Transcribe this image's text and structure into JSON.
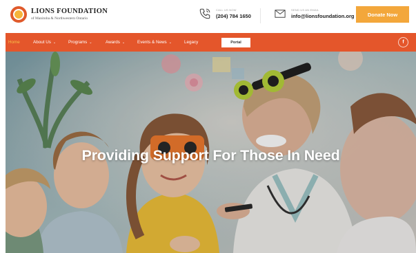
{
  "header": {
    "logo": {
      "title": "LIONS FOUNDATION",
      "subtitle": "of Manitoba & Northwestern Ontario"
    },
    "phone": {
      "label": "CALL US NOW",
      "value": "(204) 784 1650",
      "icon": "phone-icon"
    },
    "email": {
      "label": "SEND US AN EMAIL",
      "value": "info@lionsfoundation.org",
      "icon": "mail-icon"
    },
    "donate_label": "Donate Now"
  },
  "nav": {
    "items": [
      {
        "label": "Home",
        "active": true
      },
      {
        "label": "About Us",
        "dropdown": true
      },
      {
        "label": "Programs",
        "dropdown": true
      },
      {
        "label": "Awards",
        "dropdown": true
      },
      {
        "label": "Events & News",
        "dropdown": true
      },
      {
        "label": "Legacy"
      }
    ],
    "chevron": "⌄",
    "portal_label": "Portal",
    "facebook_glyph": "f"
  },
  "hero": {
    "title": "Providing Support For Those In Need"
  },
  "colors": {
    "nav_bg": "#e4562b",
    "active_nav": "#f6c34a",
    "donate_bg": "#f3a73b",
    "logo": "#e05a2b"
  }
}
